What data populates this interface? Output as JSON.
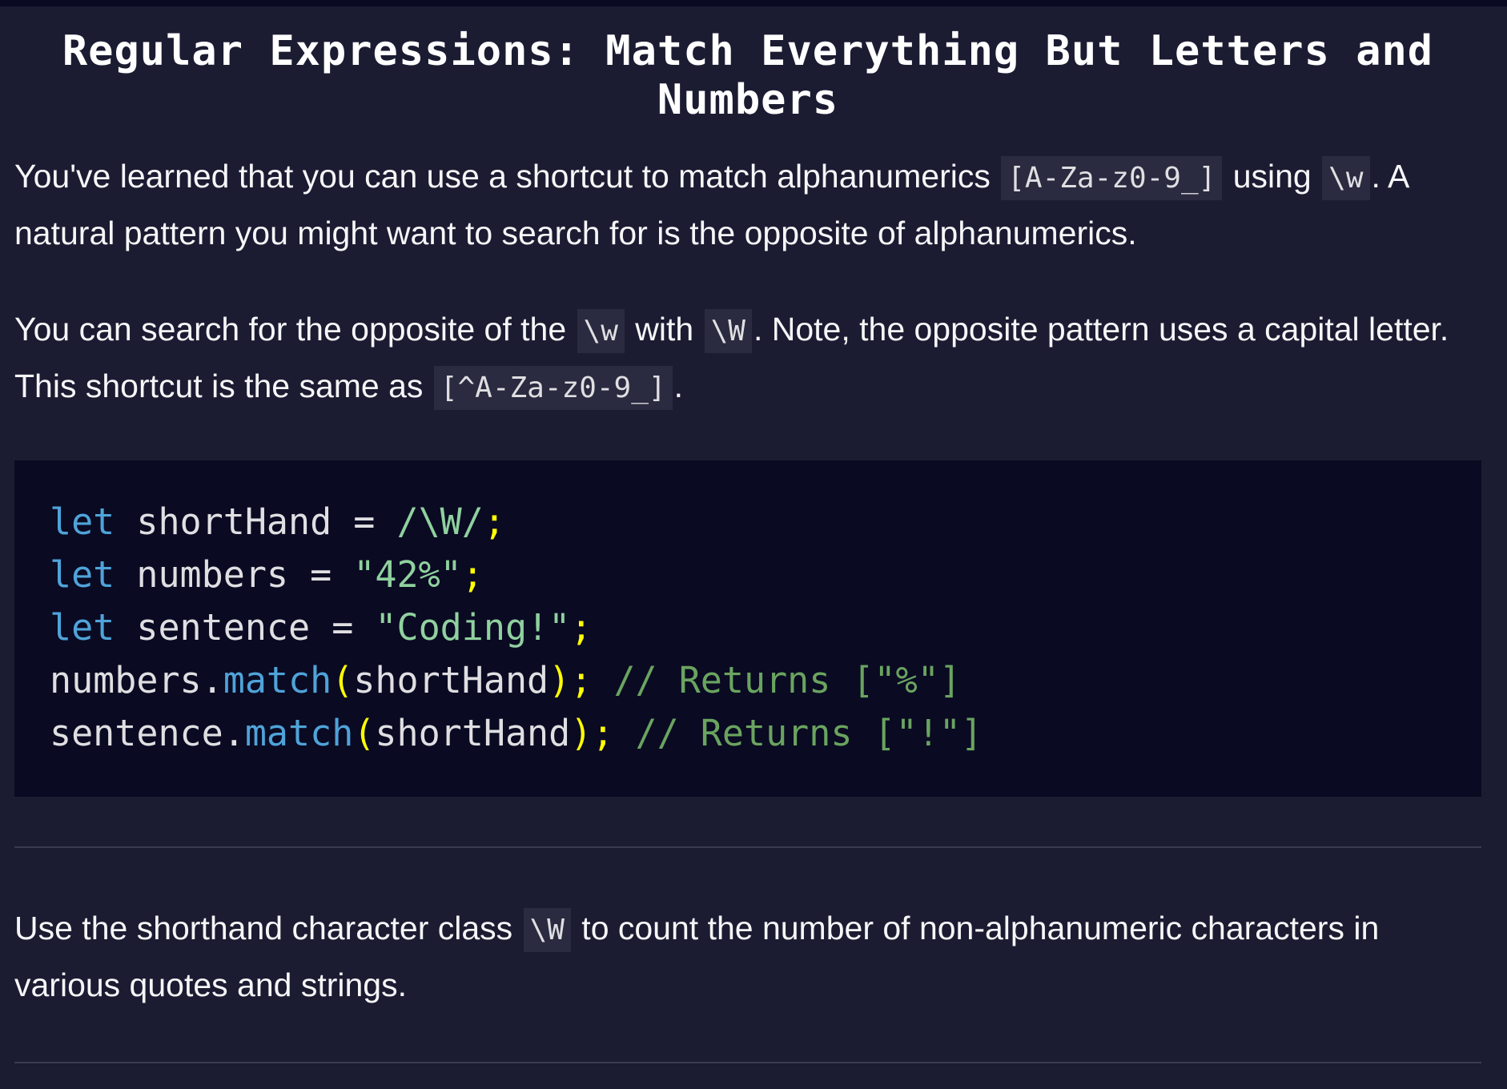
{
  "title": "Regular Expressions: Match Everything But Letters and Numbers",
  "para1": {
    "t1": "You've learned that you can use a shortcut to match alphanumerics ",
    "c1": "[A-Za-z0-9_]",
    "t2": " using ",
    "c2": "\\w",
    "t3": ". A natural pattern you might want to search for is the opposite of alphanumerics."
  },
  "para2": {
    "t1": "You can search for the opposite of the ",
    "c1": "\\w",
    "t2": " with ",
    "c2": "\\W",
    "t3": ". Note, the opposite pattern uses a capital letter. This shortcut is the same as ",
    "c3": "[^A-Za-z0-9_]",
    "t4": "."
  },
  "code": {
    "line1": {
      "kw": "let",
      "name": " shortHand ",
      "op": "=",
      "sp": " ",
      "val": "/\\W/",
      "semi": ";"
    },
    "line2": {
      "kw": "let",
      "name": " numbers ",
      "op": "=",
      "sp": " ",
      "val": "\"42%\"",
      "semi": ";"
    },
    "line3": {
      "kw": "let",
      "name": " sentence ",
      "op": "=",
      "sp": " ",
      "val": "\"Coding!\"",
      "semi": ";"
    },
    "line4": {
      "obj": "numbers",
      "dot": ".",
      "fn": "match",
      "lp": "(",
      "arg": "shortHand",
      "rp": ")",
      "semi": ";",
      "sp": " ",
      "comment": "// Returns [\"%\"]"
    },
    "line5": {
      "obj": "sentence",
      "dot": ".",
      "fn": "match",
      "lp": "(",
      "arg": "shortHand",
      "rp": ")",
      "semi": ";",
      "sp": " ",
      "comment": "// Returns [\"!\"]"
    }
  },
  "para3": {
    "t1": "Use the shorthand character class ",
    "c1": "\\W",
    "t2": " to count the number of non-alphanumeric characters in various quotes and strings."
  }
}
